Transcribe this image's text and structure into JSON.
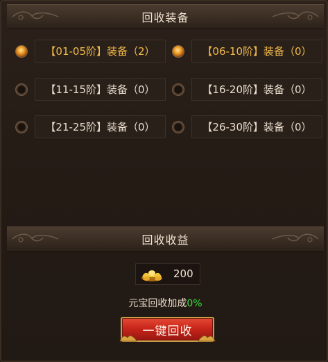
{
  "equip_section": {
    "title": "回收装备",
    "options": [
      {
        "label": "【01-05阶】装备（2）",
        "selected": true
      },
      {
        "label": "【06-10阶】装备（0）",
        "selected": true
      },
      {
        "label": "【11-15阶】装备（0）",
        "selected": false
      },
      {
        "label": "【16-20阶】装备（0）",
        "selected": false
      },
      {
        "label": "【21-25阶】装备（0）",
        "selected": false
      },
      {
        "label": "【26-30阶】装备（0）",
        "selected": false
      }
    ]
  },
  "income_section": {
    "title": "回收收益",
    "ingot_icon": "gold-ingot-icon",
    "ingot_amount": "200",
    "bonus_label": "元宝回收加成",
    "bonus_value": "0%"
  },
  "recycle_button": {
    "label": "一键回收"
  },
  "colors": {
    "active_text": "#f1b94a",
    "bonus_green": "#34e23a",
    "button_red": "#c8261b",
    "panel_bg": "#241b15"
  }
}
